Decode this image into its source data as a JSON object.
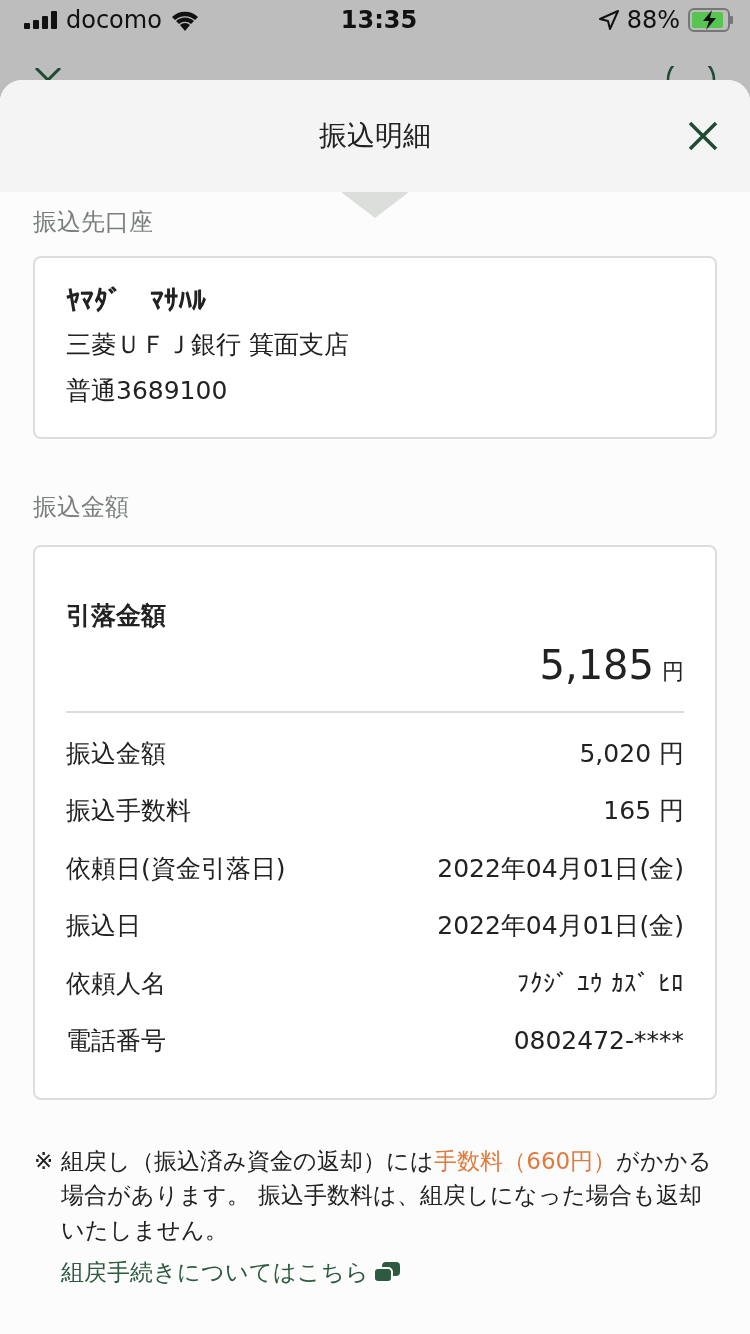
{
  "status_bar": {
    "carrier": "docomo",
    "time": "13:35",
    "battery_percent": "88%"
  },
  "sheet": {
    "title": "振込明細"
  },
  "recipient": {
    "label": "振込先口座",
    "name": "ﾔﾏﾀﾞ　ﾏｻﾊﾙ",
    "bank": "三菱ＵＦＪ銀行 箕面支店",
    "account": "普通3689100"
  },
  "amount": {
    "label": "振込金額",
    "total_label": "引落金額",
    "total_value": "5,185",
    "total_unit": "円",
    "rows": [
      {
        "label": "振込金額",
        "value": "5,020 円"
      },
      {
        "label": "振込手数料",
        "value": "165 円"
      },
      {
        "label": "依頼日(資金引落日)",
        "value": "2022年04月01日(金)"
      },
      {
        "label": "振込日",
        "value": "2022年04月01日(金)"
      },
      {
        "label": "依頼人名",
        "value": "ﾌｸｼﾞ ﾕｳ ｶｽﾞ ﾋﾛ"
      },
      {
        "label": "電話番号",
        "value": "0802472-****"
      }
    ]
  },
  "note": {
    "mark": "※",
    "segments": [
      {
        "text": "組戻し（振込済み資金の返却）には",
        "highlight": false
      },
      {
        "text": "手数料（660円）",
        "highlight": true
      },
      {
        "text": "がかかる場合があります。 振込手数料は、組戻しになった場合も返却いたしません。",
        "highlight": false
      }
    ],
    "link": "組戻手続きについてはこちら"
  }
}
